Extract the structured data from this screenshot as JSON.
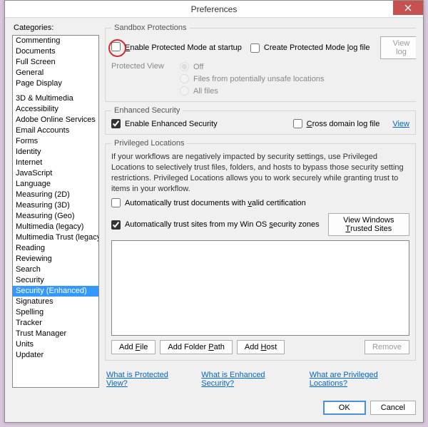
{
  "window": {
    "title": "Preferences"
  },
  "categories_label": "Categories:",
  "categories": [
    "Commenting",
    "Documents",
    "Full Screen",
    "General",
    "Page Display",
    "__sep__",
    "3D & Multimedia",
    "Accessibility",
    "Adobe Online Services",
    "Email Accounts",
    "Forms",
    "Identity",
    "Internet",
    "JavaScript",
    "Language",
    "Measuring (2D)",
    "Measuring (3D)",
    "Measuring (Geo)",
    "Multimedia (legacy)",
    "Multimedia Trust (legacy)",
    "Reading",
    "Reviewing",
    "Search",
    "Security",
    "Security (Enhanced)",
    "Signatures",
    "Spelling",
    "Tracker",
    "Trust Manager",
    "Units",
    "Updater"
  ],
  "selected_category": "Security (Enhanced)",
  "sandbox": {
    "legend": "Sandbox Protections",
    "enable_protected_label": "Enable Protected Mode at startup",
    "enable_protected_checked": false,
    "create_log_label": "Create Protected Mode log file",
    "create_log_checked": false,
    "view_log_btn": "View log",
    "protected_view_label": "Protected View",
    "pv_off": "Off",
    "pv_unsafe": "Files from potentially unsafe locations",
    "pv_all": "All files",
    "pv_selected": "Off"
  },
  "enhanced": {
    "legend": "Enhanced Security",
    "enable_label": "Enable Enhanced Security",
    "enable_checked": true,
    "cross_label": "Cross domain log file",
    "cross_checked": false,
    "view_link": "View"
  },
  "priv": {
    "legend": "Privileged Locations",
    "help": "If your workflows are negatively impacted by security settings, use Privileged Locations to selectively trust files, folders, and hosts to bypass those security setting restrictions. Privileged Locations allows you to work securely while granting trust to items in your workflow.",
    "auto_docs_label": "Automatically trust documents with valid certification",
    "auto_docs_checked": false,
    "auto_sites_label": "Automatically trust sites from my Win OS security zones",
    "auto_sites_checked": true,
    "view_trusted_btn": "View Windows Trusted Sites",
    "add_file_btn": "Add File",
    "add_folder_btn": "Add Folder Path",
    "add_host_btn": "Add Host",
    "remove_btn": "Remove"
  },
  "help_links": {
    "pv": "What is Protected View?",
    "es": "What is Enhanced Security?",
    "pl": "What are Privileged Locations?"
  },
  "footer": {
    "ok": "OK",
    "cancel": "Cancel"
  }
}
